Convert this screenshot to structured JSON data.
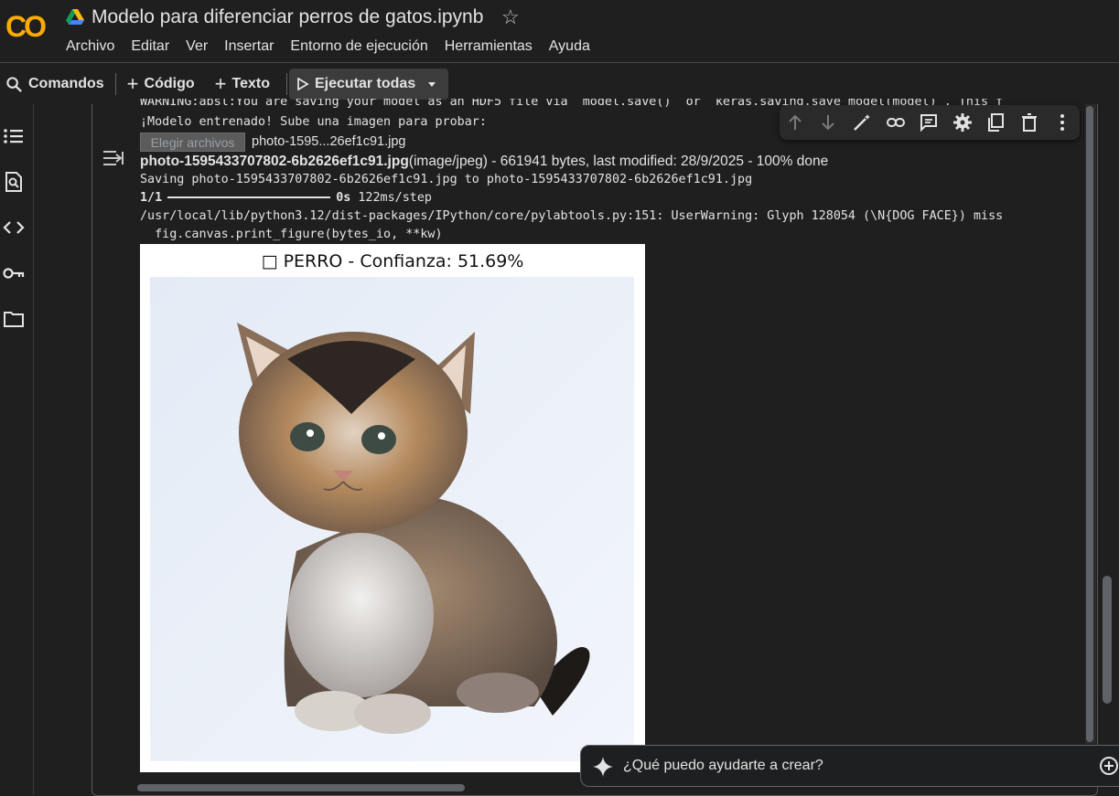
{
  "header": {
    "logo_text": "CO",
    "title": "Modelo para diferenciar perros de gatos.ipynb",
    "menu": [
      "Archivo",
      "Editar",
      "Ver",
      "Insertar",
      "Entorno de ejecución",
      "Herramientas",
      "Ayuda"
    ]
  },
  "toolbar": {
    "commands": "Comandos",
    "add_code": "Código",
    "add_text": "Texto",
    "run_all": "Ejecutar todas"
  },
  "output": {
    "clipped_line": "WARNING:absl:You are saving your model as an HDF5 file via `model.save()` or `keras.saving.save_model(model)`. This f",
    "line_trained": "¡Modelo entrenado! Sube una imagen para probar:",
    "upload_button": "Elegir archivos",
    "upload_filename": "photo-1595...26ef1c91.jpg",
    "file_name_bold": "photo-1595433707802-6b2626ef1c91.jpg",
    "file_meta": "(image/jpeg) - 661941 bytes, last modified: 28/9/2025 - 100% done",
    "saving_line": "Saving photo-1595433707802-6b2626ef1c91.jpg to photo-1595433707802-6b2626ef1c91.jpg",
    "step_count": "1/1",
    "step_time": "0s",
    "step_rate": "122ms/step",
    "warning_line": "/usr/local/lib/python3.12/dist-packages/IPython/core/pylabtools.py:151: UserWarning: Glyph 128054 (\\N{DOG FACE}) miss",
    "warning_line2": "  fig.canvas.print_figure(bytes_io, **kw)",
    "figure_title": "□ PERRO - Confianza: 51.69%"
  },
  "gemini": {
    "placeholder": "¿Qué puedo ayudarte a crear?"
  },
  "colors": {
    "background": "#1f1f1f",
    "logo_orange": "#f9ab00",
    "logo_orange_dark": "#e8710a",
    "figure_bg": "#ffffff"
  }
}
